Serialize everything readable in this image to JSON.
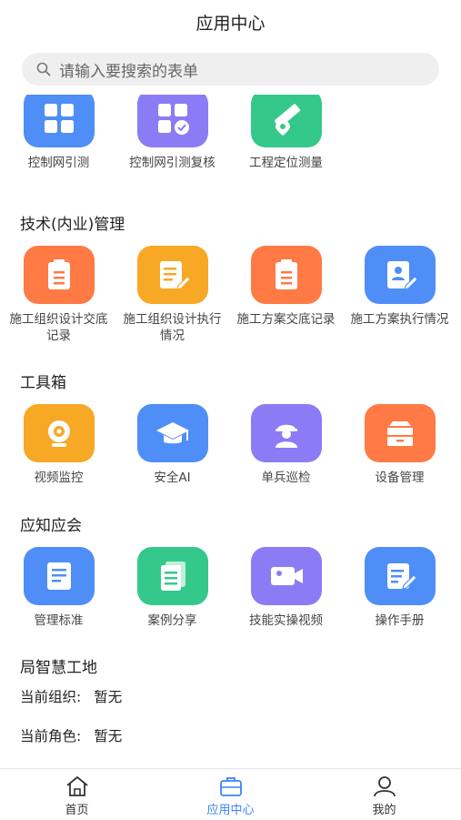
{
  "header": {
    "title": "应用中心"
  },
  "search": {
    "placeholder": "请输入要搜索的表单"
  },
  "sections": {
    "survey": {
      "items": [
        {
          "label": "控制网引测",
          "icon": "grid-icon",
          "color": "#4f8ef7"
        },
        {
          "label": "控制网引测复核",
          "icon": "grid-check-icon",
          "color": "#8b7cf6"
        },
        {
          "label": "工程定位测量",
          "icon": "ruler-location-icon",
          "color": "#34c98b"
        }
      ]
    },
    "tech": {
      "title": "技术(内业)管理",
      "items": [
        {
          "label": "施工组织设计交底记录",
          "icon": "clipboard-icon",
          "color": "#ff7a45"
        },
        {
          "label": "施工组织设计执行情况",
          "icon": "document-edit-icon",
          "color": "#f7a825"
        },
        {
          "label": "施工方案交底记录",
          "icon": "clipboard-icon",
          "color": "#ff7a45"
        },
        {
          "label": "施工方案执行情况",
          "icon": "person-document-icon",
          "color": "#4f8ef7"
        }
      ]
    },
    "toolbox": {
      "title": "工具箱",
      "items": [
        {
          "label": "视频监控",
          "icon": "camera-icon",
          "color": "#f7a825"
        },
        {
          "label": "安全AI",
          "icon": "graduation-cap-icon",
          "color": "#4f8ef7"
        },
        {
          "label": "单兵巡检",
          "icon": "worker-helmet-icon",
          "color": "#8b7cf6"
        },
        {
          "label": "设备管理",
          "icon": "archive-box-icon",
          "color": "#ff7a45"
        }
      ]
    },
    "knowledge": {
      "title": "应知应会",
      "items": [
        {
          "label": "管理标准",
          "icon": "standard-document-icon",
          "color": "#4f8ef7"
        },
        {
          "label": "案例分享",
          "icon": "stacked-documents-icon",
          "color": "#34c98b"
        },
        {
          "label": "技能实操视频",
          "icon": "video-camera-icon",
          "color": "#8b7cf6"
        },
        {
          "label": "操作手册",
          "icon": "manual-edit-icon",
          "color": "#4f8ef7"
        }
      ]
    },
    "site": {
      "title": "局智慧工地",
      "org_label": "当前组织:",
      "org_value": "暂无",
      "role_label": "当前角色:",
      "role_value": "暂无"
    }
  },
  "tabbar": {
    "items": [
      {
        "label": "首页",
        "icon": "home-icon"
      },
      {
        "label": "应用中心",
        "icon": "briefcase-icon",
        "active": true
      },
      {
        "label": "我的",
        "icon": "user-icon"
      }
    ],
    "active_color": "#3b82f6"
  }
}
